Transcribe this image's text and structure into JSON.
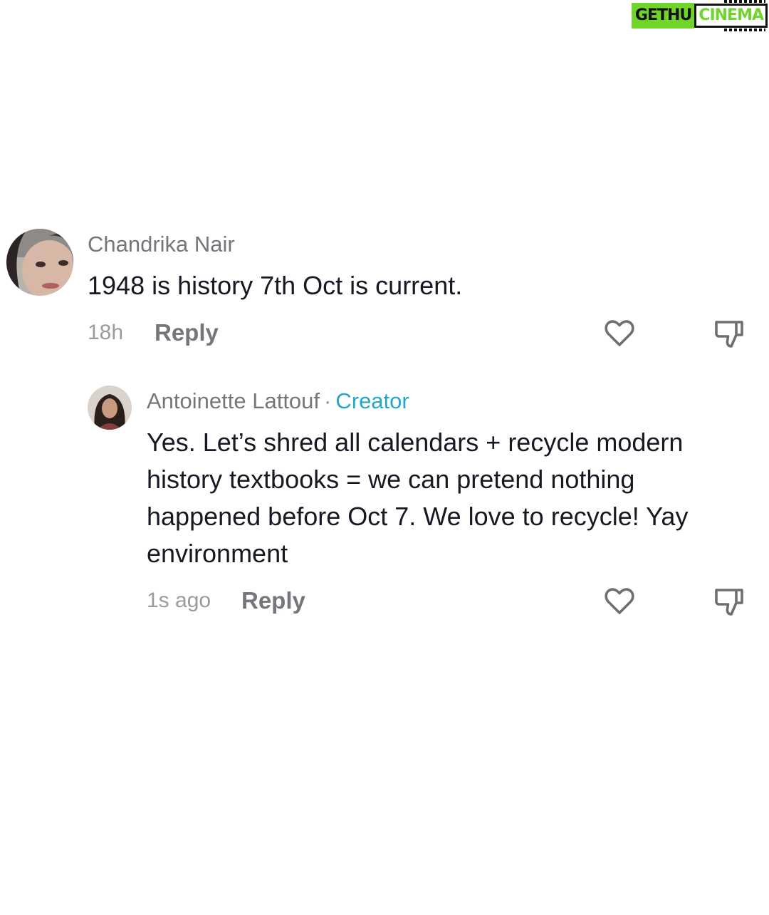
{
  "watermark": {
    "part1": "GETHU",
    "part2": "CINEMA"
  },
  "comments": [
    {
      "username": "Chandrika Nair",
      "text": "1948 is history 7th Oct is current.",
      "time": "18h",
      "reply_label": "Reply"
    },
    {
      "username": "Antoinette Lattouf",
      "separator": "·",
      "badge": "Creator",
      "text": "Yes. Let’s shred all calendars + recycle modern history textbooks = we can pretend nothing happened before Oct 7. We love to recycle! Yay environment",
      "time": "1s ago",
      "reply_label": "Reply"
    }
  ],
  "icons": {
    "like": "heart-outline-icon",
    "dislike": "thumbs-down-icon"
  },
  "colors": {
    "creator_badge": "#20a9c6",
    "text": "#161823",
    "muted": "#75767b"
  }
}
